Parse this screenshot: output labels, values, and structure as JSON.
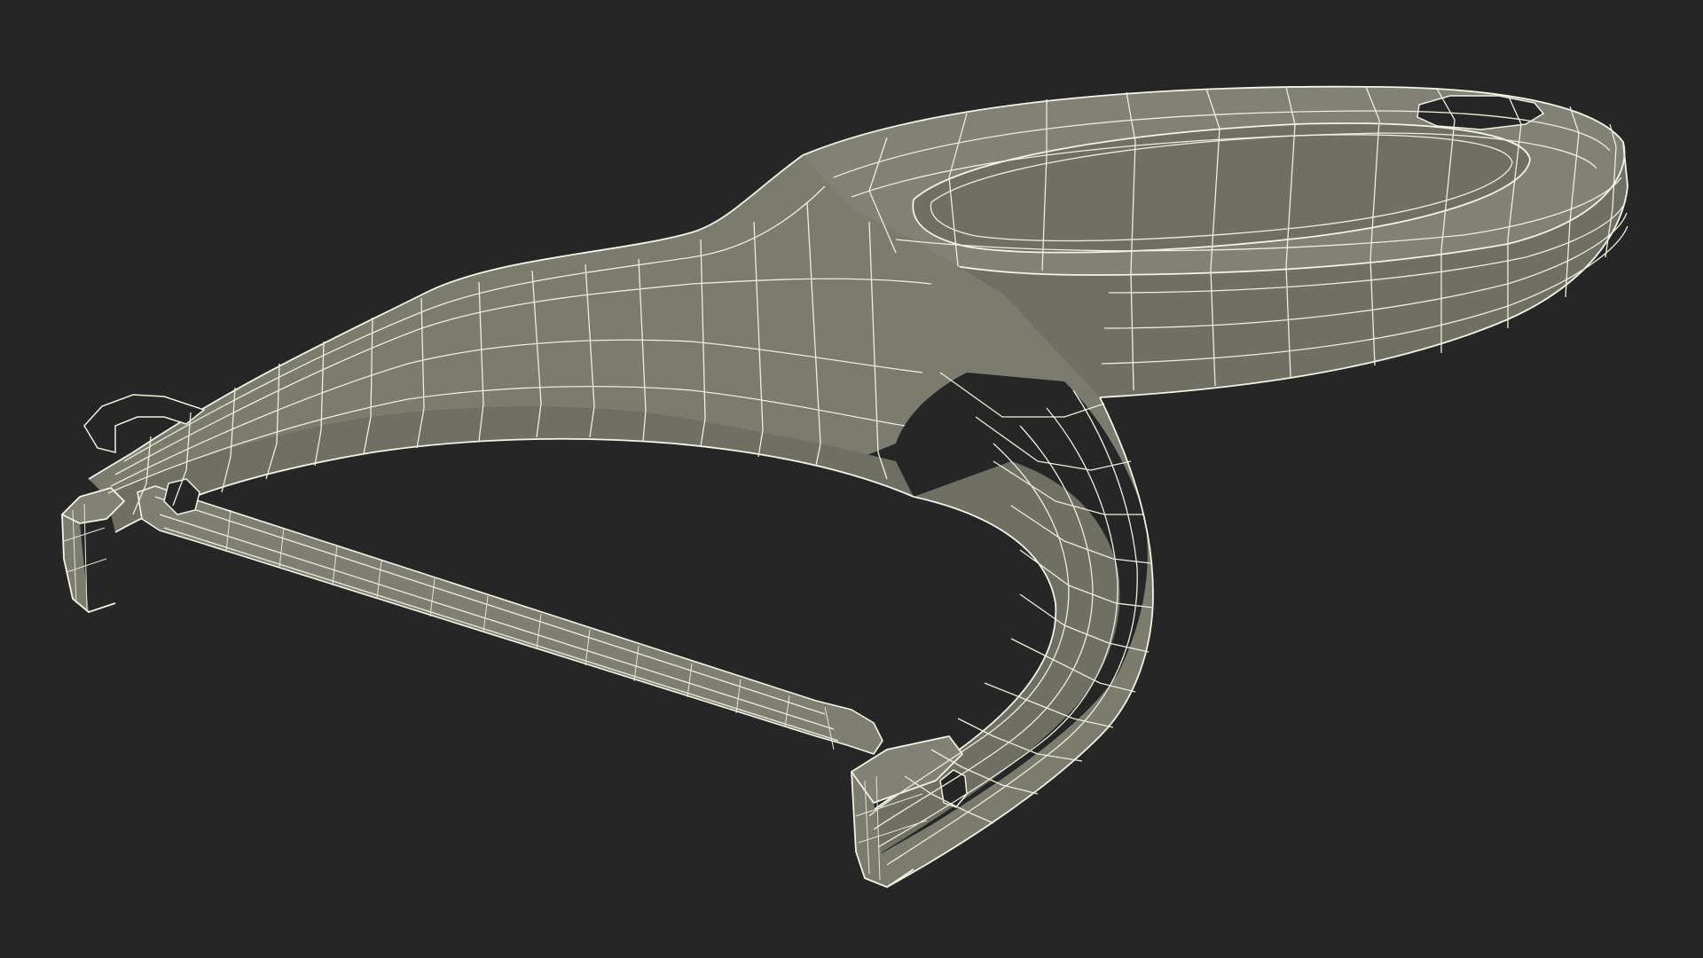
{
  "viewport": {
    "background_color": "#262626",
    "render_style": "wireframe-on-shaded",
    "surface_color": "#7b7b6e",
    "wire_color": "#eeeede"
  },
  "model": {
    "subject": "y-peeler"
  }
}
